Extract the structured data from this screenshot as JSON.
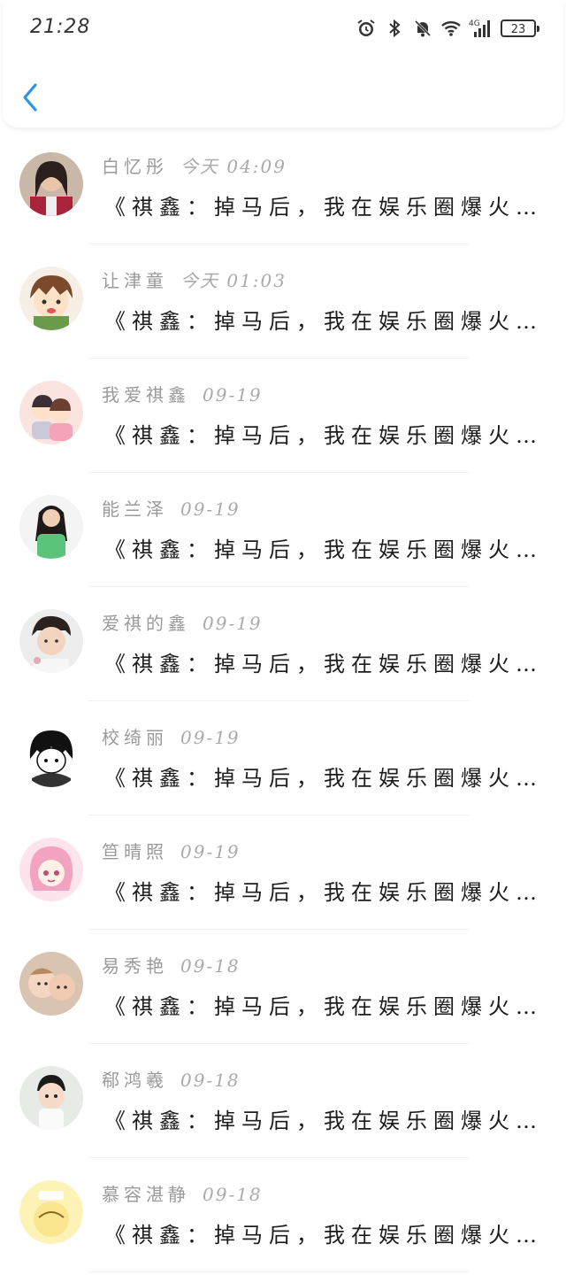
{
  "status_bar": {
    "time": "21:28",
    "battery": "23",
    "network": "4G"
  },
  "header": {
    "back_icon": "chevron-left-icon",
    "accent": "#2b95e8"
  },
  "comments": [
    {
      "name": "白忆彤",
      "time": "今天 04:09",
      "text": "《祺鑫：掉马后，我在娱乐圈爆火…",
      "avatar": "avatar-photo-girl"
    },
    {
      "name": "让津童",
      "time": "今天 01:03",
      "text": "《祺鑫：掉马后，我在娱乐圈爆火…",
      "avatar": "avatar-cartoon-boy"
    },
    {
      "name": "我爱祺鑫",
      "time": "09-19",
      "text": "《祺鑫：掉马后，我在娱乐圈爆火…",
      "avatar": "avatar-cartoon-pair"
    },
    {
      "name": "能兰泽",
      "time": "09-19",
      "text": "《祺鑫：掉马后，我在娱乐圈爆火…",
      "avatar": "avatar-girl-green"
    },
    {
      "name": "爱祺的鑫",
      "time": "09-19",
      "text": "《祺鑫：掉马后，我在娱乐圈爆火…",
      "avatar": "avatar-boy-photo"
    },
    {
      "name": "校绮丽",
      "time": "09-19",
      "text": "《祺鑫：掉马后，我在娱乐圈爆火…",
      "avatar": "avatar-anime-bw"
    },
    {
      "name": "笪晴照",
      "time": "09-19",
      "text": "《祺鑫：掉马后，我在娱乐圈爆火…",
      "avatar": "avatar-anime-pink"
    },
    {
      "name": "易秀艳",
      "time": "09-18",
      "text": "《祺鑫：掉马后，我在娱乐圈爆火…",
      "avatar": "avatar-babies"
    },
    {
      "name": "郗鸿羲",
      "time": "09-18",
      "text": "《祺鑫：掉马后，我在娱乐圈爆火…",
      "avatar": "avatar-toddler"
    },
    {
      "name": "慕容湛静",
      "time": "09-18",
      "text": "《祺鑫：掉马后，我在娱乐圈爆火…",
      "avatar": "avatar-cartoon-yellow"
    }
  ]
}
